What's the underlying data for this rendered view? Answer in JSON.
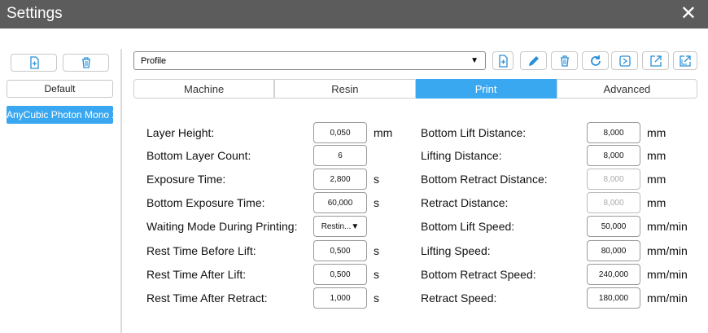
{
  "window": {
    "title": "Settings",
    "close_glyph": "✕"
  },
  "left_toolbar": {
    "add_icon": "add-file-icon",
    "delete_icon": "trash-icon"
  },
  "profiles_list": {
    "default_label": "Default",
    "selected_label": "AnyCubic Photon Mono X"
  },
  "profile_select": {
    "value": "Profile",
    "arrow": "▼"
  },
  "tabs": [
    "Machine",
    "Resin",
    "Print",
    "Advanced"
  ],
  "active_tab": "Print",
  "left_settings": [
    {
      "label": "Layer Height:",
      "value": "0,050",
      "unit": "mm"
    },
    {
      "label": "Bottom Layer Count:",
      "value": "6",
      "unit": ""
    },
    {
      "label": "Exposure Time:",
      "value": "2,800",
      "unit": "s"
    },
    {
      "label": "Bottom Exposure Time:",
      "value": "60,000",
      "unit": "s"
    },
    {
      "label": "Waiting Mode During Printing:",
      "value": "Restin...▼",
      "unit": ""
    },
    {
      "label": "Rest Time Before Lift:",
      "value": "0,500",
      "unit": "s"
    },
    {
      "label": "Rest Time After Lift:",
      "value": "0,500",
      "unit": "s"
    },
    {
      "label": "Rest Time After Retract:",
      "value": "1,000",
      "unit": "s"
    }
  ],
  "right_settings": [
    {
      "label": "Bottom Lift Distance:",
      "value": "8,000",
      "unit": "mm",
      "disabled": false
    },
    {
      "label": "Lifting Distance:",
      "value": "8,000",
      "unit": "mm",
      "disabled": false
    },
    {
      "label": "Bottom Retract Distance:",
      "value": "8,000",
      "unit": "mm",
      "disabled": true
    },
    {
      "label": "Retract Distance:",
      "value": "8,000",
      "unit": "mm",
      "disabled": true
    },
    {
      "label": "Bottom Lift Speed:",
      "value": "50,000",
      "unit": "mm/min",
      "disabled": false
    },
    {
      "label": "Lifting Speed:",
      "value": "80,000",
      "unit": "mm/min",
      "disabled": false
    },
    {
      "label": "Bottom Retract Speed:",
      "value": "240,000",
      "unit": "mm/min",
      "disabled": false
    },
    {
      "label": "Retract Speed:",
      "value": "180,000",
      "unit": "mm/min",
      "disabled": false
    }
  ],
  "colors": {
    "accent": "#3aa8f0",
    "titlebar": "#5c5c5c"
  }
}
